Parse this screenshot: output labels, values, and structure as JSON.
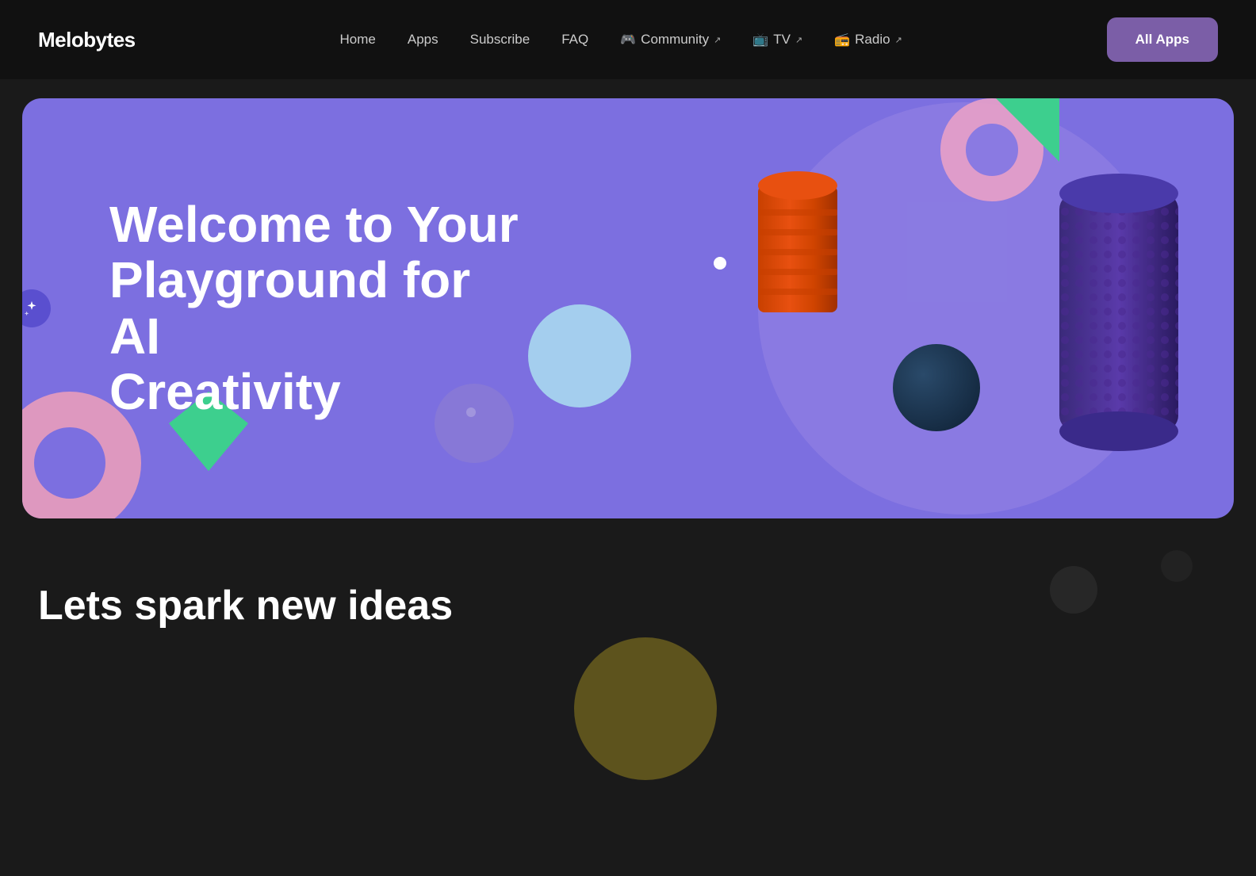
{
  "brand": {
    "logo": "Melobytes"
  },
  "navbar": {
    "links": [
      {
        "label": "Home",
        "external": false,
        "icon": ""
      },
      {
        "label": "Apps",
        "external": false,
        "icon": ""
      },
      {
        "label": "Subscribe",
        "external": false,
        "icon": ""
      },
      {
        "label": "FAQ",
        "external": false,
        "icon": ""
      },
      {
        "label": "Community",
        "external": true,
        "icon": "🎮"
      },
      {
        "label": "TV",
        "external": true,
        "icon": "📺"
      },
      {
        "label": "Radio",
        "external": true,
        "icon": "📻"
      }
    ],
    "all_apps_button": "All Apps"
  },
  "hero": {
    "title_line1": "Welcome to Your",
    "title_line2": "Playground for AI",
    "title_line3": "Creativity"
  },
  "bottom": {
    "spark_title": "Lets spark new ideas"
  },
  "side_toggle": {
    "label": "toggle-sidebar"
  }
}
